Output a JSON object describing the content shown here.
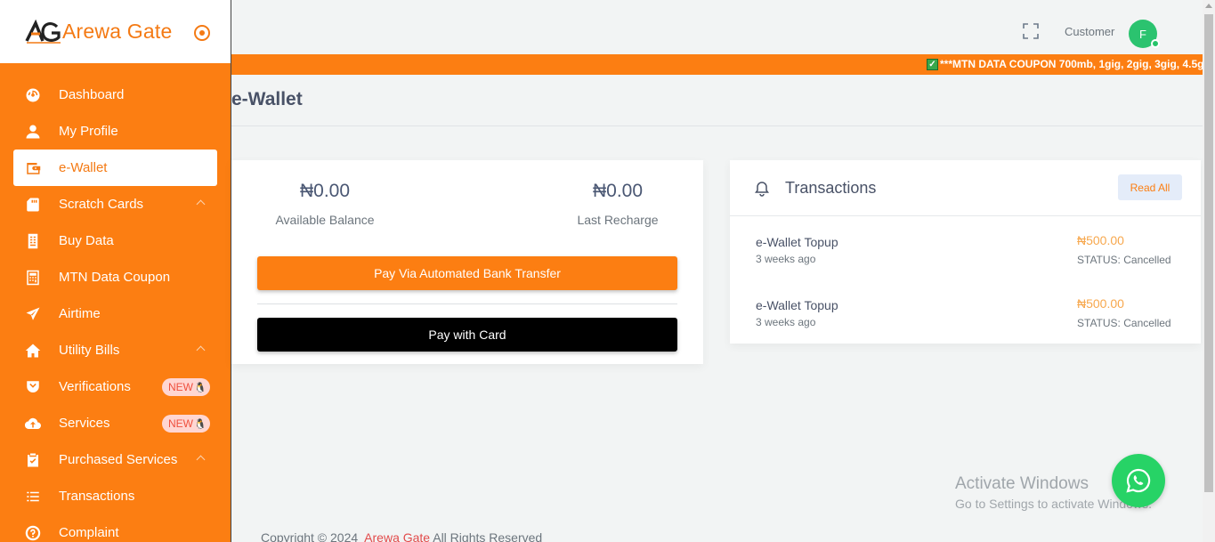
{
  "brand": {
    "name": "Arewa Gate",
    "logo_text": "AG"
  },
  "sidebar": {
    "items": [
      {
        "label": "Dashboard",
        "icon": "dashboard-icon"
      },
      {
        "label": "My Profile",
        "icon": "user-icon"
      },
      {
        "label": "e-Wallet",
        "icon": "wallet-icon",
        "active": true
      },
      {
        "label": "Scratch Cards",
        "icon": "card-icon",
        "chevron": true
      },
      {
        "label": "Buy Data",
        "icon": "data-icon"
      },
      {
        "label": "MTN Data Coupon",
        "icon": "coupon-icon"
      },
      {
        "label": "Airtime",
        "icon": "send-icon"
      },
      {
        "label": "Utility Bills",
        "icon": "home-icon",
        "chevron": true
      },
      {
        "label": "Verifications",
        "icon": "shield-icon",
        "badge": "NEW"
      },
      {
        "label": "Services",
        "icon": "cloud-upload-icon",
        "badge": "NEW"
      },
      {
        "label": "Purchased Services",
        "icon": "clipboard-check-icon",
        "chevron": true
      },
      {
        "label": "Transactions",
        "icon": "list-icon"
      },
      {
        "label": "Complaint",
        "icon": "help-icon"
      }
    ]
  },
  "header": {
    "role": "Customer",
    "avatar_initial": "F"
  },
  "ticker": {
    "text": "***MTN DATA COUPON 700mb, 1gig, 2gig, 3gig, 4.5g"
  },
  "page": {
    "title": "e-Wallet"
  },
  "wallet": {
    "available_amount": "₦0.00",
    "available_label": "Available Balance",
    "recharge_amount": "₦0.00",
    "recharge_label": "Last Recharge",
    "bank_button": "Pay Via Automated Bank Transfer",
    "card_button": "Pay with Card"
  },
  "transactions": {
    "title": "Transactions",
    "read_all": "Read All",
    "rows": [
      {
        "name": "e-Wallet Topup",
        "time": "3 weeks ago",
        "amount": "₦500.00",
        "status": "STATUS: Cancelled"
      },
      {
        "name": "e-Wallet Topup",
        "time": "3 weeks ago",
        "amount": "₦500.00",
        "status": "STATUS: Cancelled"
      }
    ]
  },
  "watermark": {
    "title": "Activate Windows",
    "subtitle": "Go to Settings to activate Windows."
  },
  "footer": {
    "prefix": "Copyright © 2024",
    "brand": "Arewa Gate",
    "suffix": "All Rights Reserved"
  },
  "colors": {
    "accent": "#fc7e12",
    "whatsapp": "#27d366",
    "avatar": "#2bc36f"
  }
}
